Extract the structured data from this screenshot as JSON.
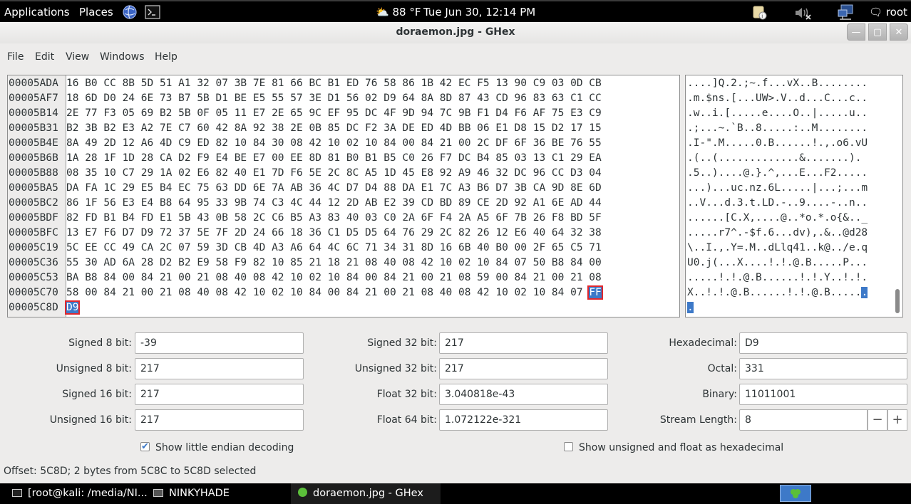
{
  "top_panel": {
    "applications": "Applications",
    "places": "Places",
    "weather": "88 °F",
    "clock": "Tue Jun 30, 12:14 PM",
    "user": "root"
  },
  "window": {
    "title": "doraemon.jpg - GHex"
  },
  "menu": {
    "file": "File",
    "edit": "Edit",
    "view": "View",
    "windows": "Windows",
    "help": "Help"
  },
  "hex_rows": [
    {
      "offset": "00005ADA",
      "bytes": "16 B0 CC 8B 5D 51 A1 32 07 3B 7E 81 66 BC B1 ED 76 58 86 1B 42 EC F5 13 90 C9 03 0D CB",
      "ascii": "....]Q.2.;~.f...vX..B........"
    },
    {
      "offset": "00005AF7",
      "bytes": "18 6D D0 24 6E 73 B7 5B D1 BE E5 55 57 3E D1 56 02 D9 64 8A 8D 87 43 CD 96 83 63 C1 CC",
      "ascii": ".m.$ns.[...UW>.V..d...C...c.."
    },
    {
      "offset": "00005B14",
      "bytes": "2E 77 F3 05 69 B2 5B 0F 05 11 E7 2E 65 9C EF 95 DC 4F 9D 94 7C 9B F1 D4 F6 AF 75 E3 C9",
      "ascii": ".w..i.[.....e....O..|.....u.."
    },
    {
      "offset": "00005B31",
      "bytes": "B2 3B B2 E3 A2 7E C7 60 42 8A 92 38 2E 0B 85 DC F2 3A DE ED 4D BB 06 E1 D8 15 D2 17 15",
      "ascii": ".;...~.`B..8.....:..M........"
    },
    {
      "offset": "00005B4E",
      "bytes": "8A 49 2D 12 A6 4D C9 ED 82 10 84 30 08 42 10 02 10 84 00 84 21 00 2C DF 6F 36 BE 76 55",
      "ascii": ".I-\".M.....0.B......!.,.o6.vU"
    },
    {
      "offset": "00005B6B",
      "bytes": "1A 28 1F 1D 28 CA D2 F9 E4 BE E7 00 EE 8D 81 B0 B1 B5 C0 26 F7 DC B4 85 03 13 C1 29 EA",
      "ascii": ".(..(.............&.......)."
    },
    {
      "offset": "00005B88",
      "bytes": "08 35 10 C7 29 1A 02 E6 82 40 E1 7D F6 5E 2C 8C A5 1D 45 E8 92 A9 46 32 DC 96 CC D3 04",
      "ascii": ".5..)....@.}.^,...E...F2....."
    },
    {
      "offset": "00005BA5",
      "bytes": "DA FA 1C 29 E5 B4 EC 75 63 DD 6E 7A AB 36 4C D7 D4 88 DA E1 7C A3 B6 D7 3B CA 9D 8E 6D",
      "ascii": "...)...uc.nz.6L.....|...;...m"
    },
    {
      "offset": "00005BC2",
      "bytes": "86 1F 56 E3 E4 B8 64 95 33 9B 74 C3 4C 44 12 2D AB E2 39 CD BD 89 CE 2D 92 A1 6E AD 44",
      "ascii": "..V...d.3.t.LD.-..9....-..n.."
    },
    {
      "offset": "00005BDF",
      "bytes": "82 FD B1 B4 FD E1 5B 43 0B 58 2C C6 B5 A3 83 40 03 C0 2A 6F F4 2A A5 6F 7B 26 F8 BD 5F",
      "ascii": "......[C.X,....@..*o.*.o{&.._"
    },
    {
      "offset": "00005BFC",
      "bytes": "13 E7 F6 D7 D9 72 37 5E 7F 2D 24 66 18 36 C1 D5 D5 64 76 29 2C 82 26 12 E6 40 64 32 38",
      "ascii": ".....r7^.-$f.6...dv),.&..@d28"
    },
    {
      "offset": "00005C19",
      "bytes": "5C EE CC 49 CA 2C 07 59 3D CB 4D A3 A6 64 4C 6C 71 34 31 8D 16 6B 40 B0 00 2F 65 C5 71",
      "ascii": "\\..I.,.Y=.M..dLlq41..k@../e.q"
    },
    {
      "offset": "00005C36",
      "bytes": "55 30 AD 6A 28 D2 B2 E9 58 F9 82 10 85 21 18 21 08 40 08 42 10 02 10 84 07 50 B8 84 00",
      "ascii": "U0.j(...X....!.!.@.B.....P..."
    },
    {
      "offset": "00005C53",
      "bytes": "BA B8 84 00 84 21 00 21 08 40 08 42 10 02 10 84 00 84 21 00 21 08 59 00 84 21 00 21 08",
      "ascii": ".....!.!.@.B......!.!.Y..!.!."
    },
    {
      "offset": "00005C70",
      "bytes": "58 00 84 21 00 21 08 40 08 42 10 02 10 84 00 84 21 00 21 08 40 08 42 10 02 10 84 07",
      "last_byte": "FF",
      "ascii": "X..!.!.@.B......!.!.@.B.....",
      "ascii_sel": "."
    },
    {
      "offset": "00005C8D",
      "bytes": "",
      "first_byte": "D9",
      "ascii": "",
      "ascii_sel": "."
    }
  ],
  "fields": {
    "signed8_label": "Signed 8 bit:",
    "signed8": "-39",
    "unsigned8_label": "Unsigned 8 bit:",
    "unsigned8": "217",
    "signed16_label": "Signed 16 bit:",
    "signed16": "217",
    "unsigned16_label": "Unsigned 16 bit:",
    "unsigned16": "217",
    "signed32_label": "Signed 32 bit:",
    "signed32": "217",
    "unsigned32_label": "Unsigned 32 bit:",
    "unsigned32": "217",
    "float32_label": "Float 32 bit:",
    "float32": "3.040818e-43",
    "float64_label": "Float 64 bit:",
    "float64": "1.072122e-321",
    "hex_label": "Hexadecimal:",
    "hex": "D9",
    "octal_label": "Octal:",
    "octal": "331",
    "binary_label": "Binary:",
    "binary": "11011001",
    "stream_label": "Stream Length:",
    "stream": "8"
  },
  "checkboxes": {
    "little_endian": "Show little endian decoding",
    "little_endian_checked": true,
    "unsigned_hex": "Show unsigned and float as hexadecimal",
    "unsigned_hex_checked": false
  },
  "status": "Offset: 5C8D; 2 bytes from 5C8C to 5C8D selected",
  "taskbar": {
    "task1": "[root@kali: /media/NI...",
    "task2": "NINKYHADE",
    "task3": "doraemon.jpg - GHex"
  },
  "colors": {
    "selection": "#3d79c8",
    "highlight_box": "#e0272d"
  }
}
